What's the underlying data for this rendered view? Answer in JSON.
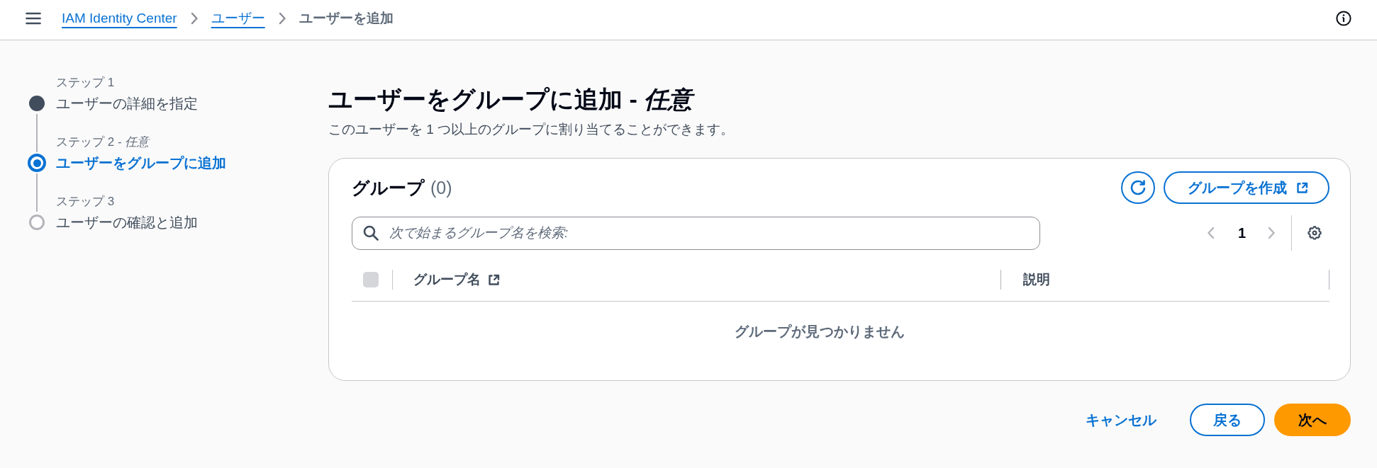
{
  "top_bar": {
    "breadcrumbs": [
      {
        "label": "IAM Identity Center",
        "kind": "link"
      },
      {
        "label": "ユーザー",
        "kind": "link"
      },
      {
        "label": "ユーザーを追加",
        "kind": "current"
      }
    ]
  },
  "steps": [
    {
      "label": "ステップ 1",
      "title": "ユーザーの詳細を指定",
      "completed": true,
      "selected": false
    },
    {
      "label": "ステップ 2 - *任意*",
      "title": "ユーザーをグループに追加",
      "completed": false,
      "selected": true
    },
    {
      "label": "ステップ 3",
      "title": "ユーザーの確認と追加",
      "completed": false,
      "selected": false
    }
  ],
  "page": {
    "title": "ユーザーをグループに追加 - *任意*",
    "description": "このユーザーを 1 つ以上のグループに割り当てることができます。"
  },
  "groups_panel": {
    "title": "グループ",
    "count": "(0)",
    "create_button": "グループを作成",
    "search": {
      "placeholder": "次で始まるグループ名を検索:"
    },
    "pagination": {
      "previous_disabled": true,
      "page": "1",
      "next_disabled": true
    },
    "table": {
      "select_all": {
        "checked": false,
        "disabled": true
      },
      "columns": [
        {
          "label": "グループ名",
          "external_link": true
        },
        {
          "label": "説明",
          "external_link": false
        }
      ],
      "empty_text": "グループが見つかりません"
    }
  },
  "footer_buttons": [
    {
      "label": "キャンセル",
      "kind": "link"
    },
    {
      "label": "戻る",
      "kind": "normal"
    },
    {
      "label": "次へ",
      "kind": "primary"
    }
  ]
}
